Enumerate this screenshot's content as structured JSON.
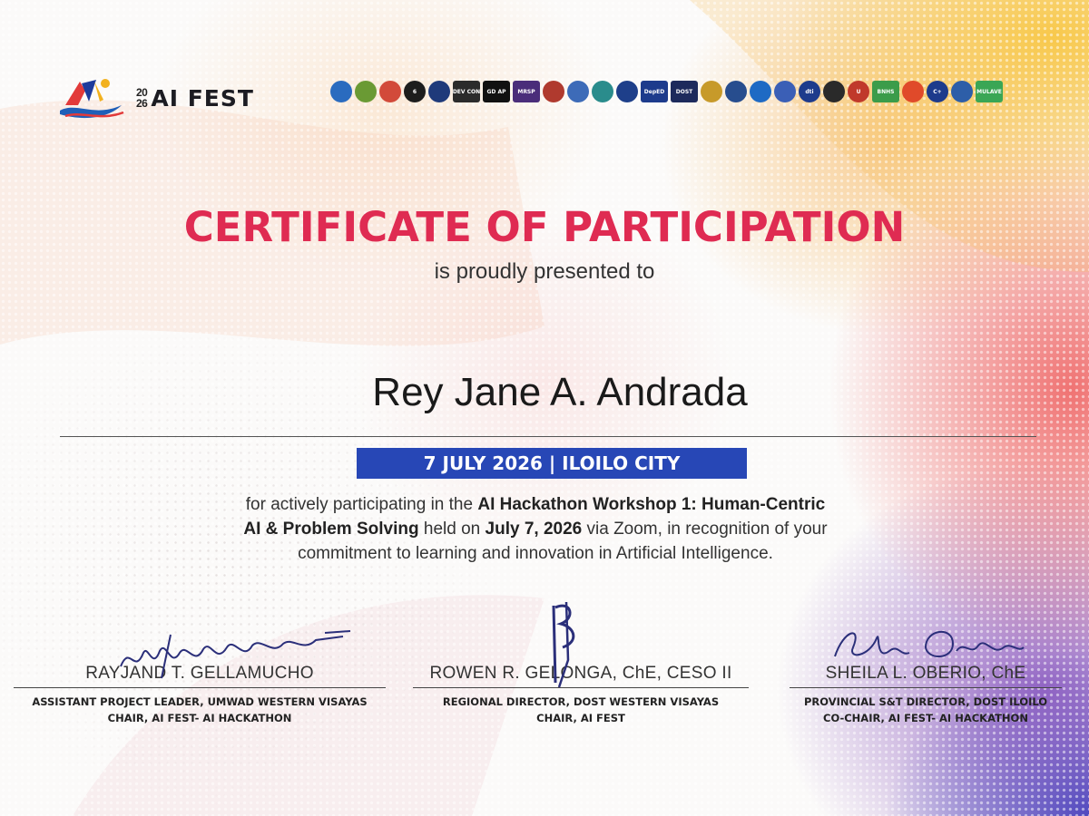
{
  "header": {
    "logo": {
      "year_top": "20",
      "year_bottom": "26",
      "name": "AI FEST"
    },
    "partner_logos": [
      {
        "icon": "cicon-logo",
        "color": "#2a6bbf",
        "label": ""
      },
      {
        "icon": "leaf-logo",
        "color": "#6a9a34",
        "label": ""
      },
      {
        "icon": "innovate-iloilo-logo",
        "color": "#d24a3a",
        "label": ""
      },
      {
        "icon": "iloilo-business-club-logo",
        "color": "#1d1d1d",
        "label": "6"
      },
      {
        "icon": "university-seal-logo",
        "color": "#1f3a7a",
        "label": ""
      },
      {
        "icon": "devcon-logo",
        "color": "#2b2b2b",
        "label": "DEV CON"
      },
      {
        "icon": "gdg-logo",
        "color": "#111111",
        "label": "GD AP"
      },
      {
        "icon": "mrsp-logo",
        "color": "#4a2d7a",
        "label": "MRSP"
      },
      {
        "icon": "seal-logo-1",
        "color": "#b03a2e",
        "label": ""
      },
      {
        "icon": "seal-logo-2",
        "color": "#3d6bb8",
        "label": ""
      },
      {
        "icon": "seal-logo-3",
        "color": "#2a8c8c",
        "label": ""
      },
      {
        "icon": "seal-logo-4",
        "color": "#1e3f8a",
        "label": ""
      },
      {
        "icon": "deped-logo",
        "color": "#1d3b8c",
        "label": "DepED"
      },
      {
        "icon": "dost-logo",
        "color": "#1d2a5c",
        "label": "DOST"
      },
      {
        "icon": "seal-logo-5",
        "color": "#c79a2a",
        "label": ""
      },
      {
        "icon": "seal-logo-6",
        "color": "#274d8e",
        "label": ""
      },
      {
        "icon": "seal-logo-7",
        "color": "#1e6ac4",
        "label": ""
      },
      {
        "icon": "dict-logo",
        "color": "#3b5fb6",
        "label": ""
      },
      {
        "icon": "dti-logo",
        "color": "#1d3b8c",
        "label": "dti"
      },
      {
        "icon": "gear-seal-logo",
        "color": "#2a2a2a",
        "label": ""
      },
      {
        "icon": "u-logo",
        "color": "#c0392b",
        "label": "U"
      },
      {
        "icon": "bnhs-logo",
        "color": "#3b9c4a",
        "label": "BNHS"
      },
      {
        "icon": "flower-logo",
        "color": "#e04a2a",
        "label": ""
      },
      {
        "icon": "c-plus-logo",
        "color": "#1d3b8c",
        "label": "C+"
      },
      {
        "icon": "plane-logo",
        "color": "#2d5ea8",
        "label": ""
      },
      {
        "icon": "mulave-logo",
        "color": "#3aa655",
        "label": "MULAVE"
      }
    ]
  },
  "certificate": {
    "title": "CERTIFICATE OF PARTICIPATION",
    "subtitle": "is proudly presented to",
    "recipient": "Rey Jane A. Andrada",
    "date_location": "7 JULY 2026 | ILOILO CITY",
    "body": {
      "line1_prefix": "for actively participating in the ",
      "event_part1": "AI Hackathon Workshop 1: Human-Centric",
      "event_part2": "AI & Problem Solving",
      "line2_mid": " held on ",
      "date_bold": "July 7, 2026",
      "line2_suffix": " via Zoom, in recognition of your",
      "line3": "commitment to learning and innovation in Artificial Intelligence."
    }
  },
  "signatories": [
    {
      "name": "RAYJAND T. GELLAMUCHO",
      "title_line1": "ASSISTANT PROJECT LEADER, UMWAD WESTERN VISAYAS",
      "title_line2": "CHAIR, AI FEST- AI HACKATHON",
      "signature_text": "Rayjandgellamucho"
    },
    {
      "name": "ROWEN R. GELONGA, ChE, CESO II",
      "title_line1": "REGIONAL DIRECTOR, DOST WESTERN VISAYAS",
      "title_line2": "CHAIR, AI FEST",
      "signature_text": "RG"
    },
    {
      "name": "SHEILA L. OBERIO, ChE",
      "title_line1": "PROVINCIAL S&T DIRECTOR, DOST ILOILO",
      "title_line2": "CO-CHAIR, AI FEST- AI HACKATHON",
      "signature_text": "Sheila Oberio"
    }
  ]
}
